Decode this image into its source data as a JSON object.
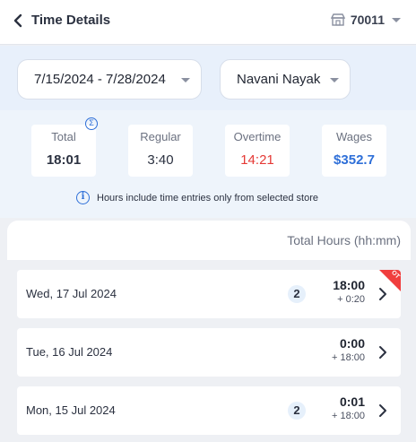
{
  "header": {
    "title": "Time Details",
    "store_number": "70011"
  },
  "filters": {
    "date_range": "7/15/2024 - 7/28/2024",
    "employee": "Navani Nayak"
  },
  "summary": {
    "stats": [
      {
        "label": "Total",
        "value": "18:01"
      },
      {
        "label": "Regular",
        "value": "3:40"
      },
      {
        "label": "Overtime",
        "value": "14:21"
      },
      {
        "label": "Wages",
        "value": "$352.7"
      }
    ],
    "sigma_symbol": "Σ",
    "note": "Hours include time entries only from selected store"
  },
  "list": {
    "header": "Total Hours (hh:mm)",
    "days": [
      {
        "date": "Wed, 17 Jul 2024",
        "count": "2",
        "hours": "18:00",
        "extra": "+ 0:20",
        "ot_label": "OT"
      },
      {
        "date": "Tue, 16 Jul 2024",
        "count": "",
        "hours": "0:00",
        "extra": "+ 18:00"
      },
      {
        "date": "Mon, 15 Jul 2024",
        "count": "2",
        "hours": "0:01",
        "extra": "+ 18:00"
      }
    ]
  },
  "colors": {
    "accent": "#2e6fd8",
    "overtime": "#e53935",
    "ot_badge": "#f03e3e"
  }
}
